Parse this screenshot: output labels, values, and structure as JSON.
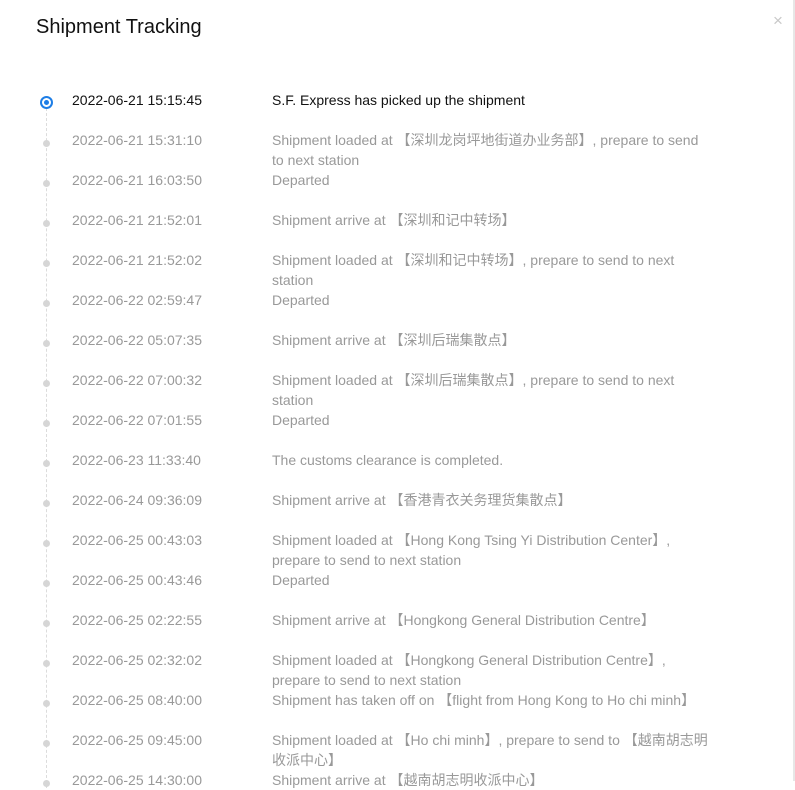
{
  "dialog": {
    "title": "Shipment Tracking",
    "close_label": "×"
  },
  "events": [
    {
      "time": "2022-06-21 15:15:45",
      "desc": "S.F. Express has picked up the shipment",
      "current": true
    },
    {
      "time": "2022-06-21 15:31:10",
      "desc": "Shipment loaded at 【深圳龙岗坪地街道办业务部】, prepare to send to next station"
    },
    {
      "time": "2022-06-21 16:03:50",
      "desc": "Departed"
    },
    {
      "time": "2022-06-21 21:52:01",
      "desc": "Shipment arrive at 【深圳和记中转场】"
    },
    {
      "time": "2022-06-21 21:52:02",
      "desc": "Shipment loaded at 【深圳和记中转场】, prepare to send to next station"
    },
    {
      "time": "2022-06-22 02:59:47",
      "desc": "Departed"
    },
    {
      "time": "2022-06-22 05:07:35",
      "desc": "Shipment arrive at 【深圳后瑞集散点】"
    },
    {
      "time": "2022-06-22 07:00:32",
      "desc": "Shipment loaded at 【深圳后瑞集散点】, prepare to send to next station"
    },
    {
      "time": "2022-06-22 07:01:55",
      "desc": "Departed"
    },
    {
      "time": "2022-06-23 11:33:40",
      "desc": "The customs clearance is completed."
    },
    {
      "time": "2022-06-24 09:36:09",
      "desc": "Shipment arrive at 【香港青衣关务理货集散点】"
    },
    {
      "time": "2022-06-25 00:43:03",
      "desc": "Shipment loaded at 【Hong Kong Tsing Yi Distribution Center】, prepare to send to next station"
    },
    {
      "time": "2022-06-25 00:43:46",
      "desc": "Departed"
    },
    {
      "time": "2022-06-25 02:22:55",
      "desc": "Shipment arrive at 【Hongkong General Distribution Centre】"
    },
    {
      "time": "2022-06-25 02:32:02",
      "desc": "Shipment loaded at 【Hongkong General Distribution Centre】, prepare to send to next station"
    },
    {
      "time": "2022-06-25 08:40:00",
      "desc": "Shipment has taken off on 【flight from Hong Kong to Ho chi minh】"
    },
    {
      "time": "2022-06-25 09:45:00",
      "desc": "Shipment loaded at 【Ho chi minh】, prepare to send to 【越南胡志明收派中心】"
    },
    {
      "time": "2022-06-25 14:30:00",
      "desc": "Shipment arrive at 【越南胡志明收派中心】"
    }
  ]
}
